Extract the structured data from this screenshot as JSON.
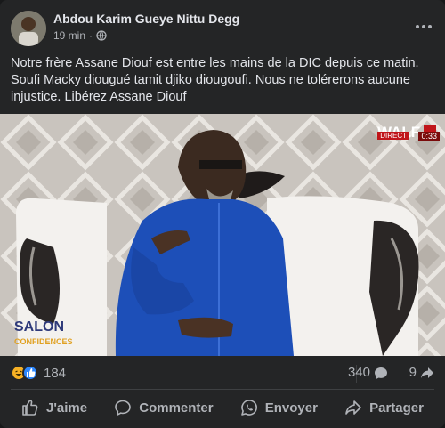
{
  "post": {
    "author": "Abdou Karim Gueye Nittu Degg",
    "time": "19 min",
    "meta_separator": "·",
    "text": "Notre frère Assane Diouf est entre les mains de la DIC depuis ce matin. Soufi Macky diougué tamit djiko diougoufi.  Nous ne tolérerons aucune injustice. Libérez Assane Diouf"
  },
  "media": {
    "watermark": "WALF",
    "live_badge": "DIRECT",
    "timecode": "0:33",
    "lower_text_1": "SALON",
    "lower_text_2": "CONFIDENCES"
  },
  "reactions": {
    "types": [
      "haha-icon",
      "like-icon"
    ],
    "count": "184",
    "comments_count": "340",
    "shares_count": "9"
  },
  "actions": {
    "like": "J'aime",
    "comment": "Commenter",
    "send": "Envoyer",
    "share": "Partager"
  },
  "colors": {
    "background": "#242526",
    "text_primary": "#e4e6eb",
    "text_secondary": "#b0b3b8",
    "like_blue": "#2d88ff",
    "haha_yellow": "#f7b125",
    "suit_blue": "#1d4fb8"
  }
}
